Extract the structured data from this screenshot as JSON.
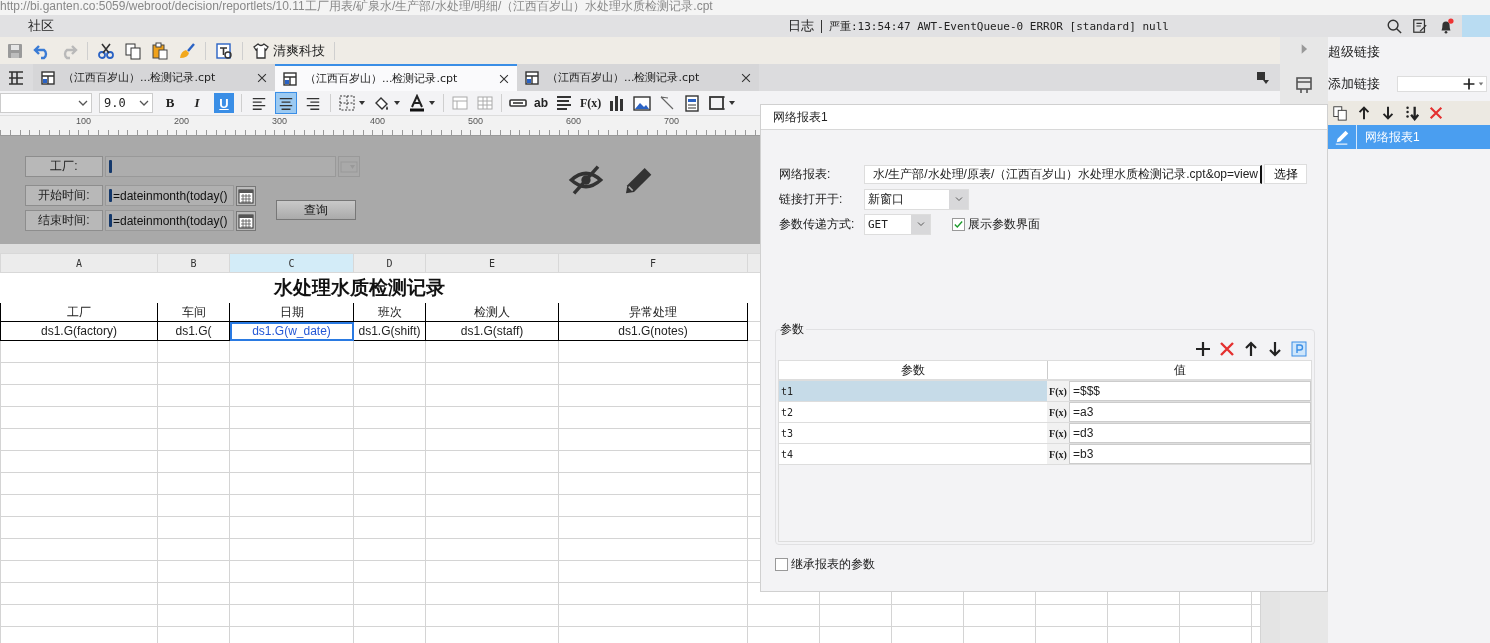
{
  "address_bar": {
    "url": "http://bi.ganten.co:5059/webroot/decision/reportlets/10.11工厂用表/矿泉水/生产部/水处理/明细/（江西百岁山）水处理水质检测记录.cpt"
  },
  "menu_bar": {
    "items": [
      "社区"
    ],
    "log_label": "日志",
    "log_message": "严重:13:54:47 AWT-EventQueue-0 ERROR [standard] null"
  },
  "toolbar": {
    "company": "清爽科技"
  },
  "tabs": [
    {
      "label": "（江西百岁山）...检测记录.cpt",
      "selected": false
    },
    {
      "label": "（江西百岁山）...检测记录.cpt",
      "selected": true
    },
    {
      "label": "（江西百岁山）...检测记录.cpt",
      "selected": false
    }
  ],
  "format_bar": {
    "font_size": "9.0",
    "style_buttons": [
      {
        "label": "B",
        "selected": false
      },
      {
        "label": "I",
        "selected": false
      },
      {
        "label": "U",
        "selected": true
      }
    ],
    "align_buttons": [
      {
        "kind": "left",
        "selected": false
      },
      {
        "kind": "center",
        "selected": true
      },
      {
        "kind": "right",
        "selected": false
      }
    ],
    "text_tool": "ab",
    "formula_tool": "F(x)"
  },
  "ruler": {
    "labels": [
      "100",
      "200",
      "300",
      "400",
      "500",
      "600",
      "700"
    ]
  },
  "parameter_pane": {
    "fields": [
      {
        "label": "工厂:",
        "kind": "combo"
      },
      {
        "label": "开始时间:",
        "kind": "date",
        "value": "=dateinmonth(today()"
      },
      {
        "label": "结束时间:",
        "kind": "date",
        "value": "=dateinmonth(today()"
      }
    ],
    "query_button": "查询"
  },
  "sheet": {
    "columns": [
      {
        "label": "A",
        "selected": false
      },
      {
        "label": "B",
        "selected": false
      },
      {
        "label": "C",
        "selected": true
      },
      {
        "label": "D",
        "selected": false
      },
      {
        "label": "E",
        "selected": false
      },
      {
        "label": "F",
        "selected": false
      }
    ],
    "title": "水处理水质检测记录",
    "header": [
      "工厂",
      "车间",
      "日期",
      "班次",
      "检测人",
      "异常处理"
    ],
    "data": [
      {
        "text": "ds1.G(factory)",
        "selected": false
      },
      {
        "text": "ds1.G(",
        "selected": false
      },
      {
        "text": "ds1.G(w_date)",
        "selected": true
      },
      {
        "text": "ds1.G(shift)",
        "selected": false
      },
      {
        "text": "ds1.G(staff)",
        "selected": false
      },
      {
        "text": "ds1.G(notes)",
        "selected": false
      }
    ]
  },
  "dialog": {
    "title": "网络报表1",
    "report_label": "网络报表:",
    "report_path": "水/生产部/水处理/原表/（江西百岁山）水处理水质检测记录.cpt&op=view",
    "choose_button": "选择",
    "open_in_label": "链接打开于:",
    "open_in": "新窗口",
    "method_label": "参数传递方式:",
    "method": "GET",
    "show_params": {
      "label": "展示参数界面",
      "checked": true
    },
    "params_group": "参数",
    "param_columns": [
      "参数",
      "值"
    ],
    "params": [
      {
        "name": "t1",
        "formula": "F(x)",
        "value": "=$$$",
        "selected": true
      },
      {
        "name": "t2",
        "formula": "F(x)",
        "value": "=a3",
        "selected": false
      },
      {
        "name": "t3",
        "formula": "F(x)",
        "value": "=d3",
        "selected": false
      },
      {
        "name": "t4",
        "formula": "F(x)",
        "value": "=b3",
        "selected": false
      }
    ],
    "inherit": {
      "label": "继承报表的参数",
      "checked": false
    }
  },
  "side_panel": {
    "title": "超级链接",
    "add_label": "添加链接",
    "links": [
      {
        "name": "网络报表1",
        "selected": true
      }
    ]
  }
}
